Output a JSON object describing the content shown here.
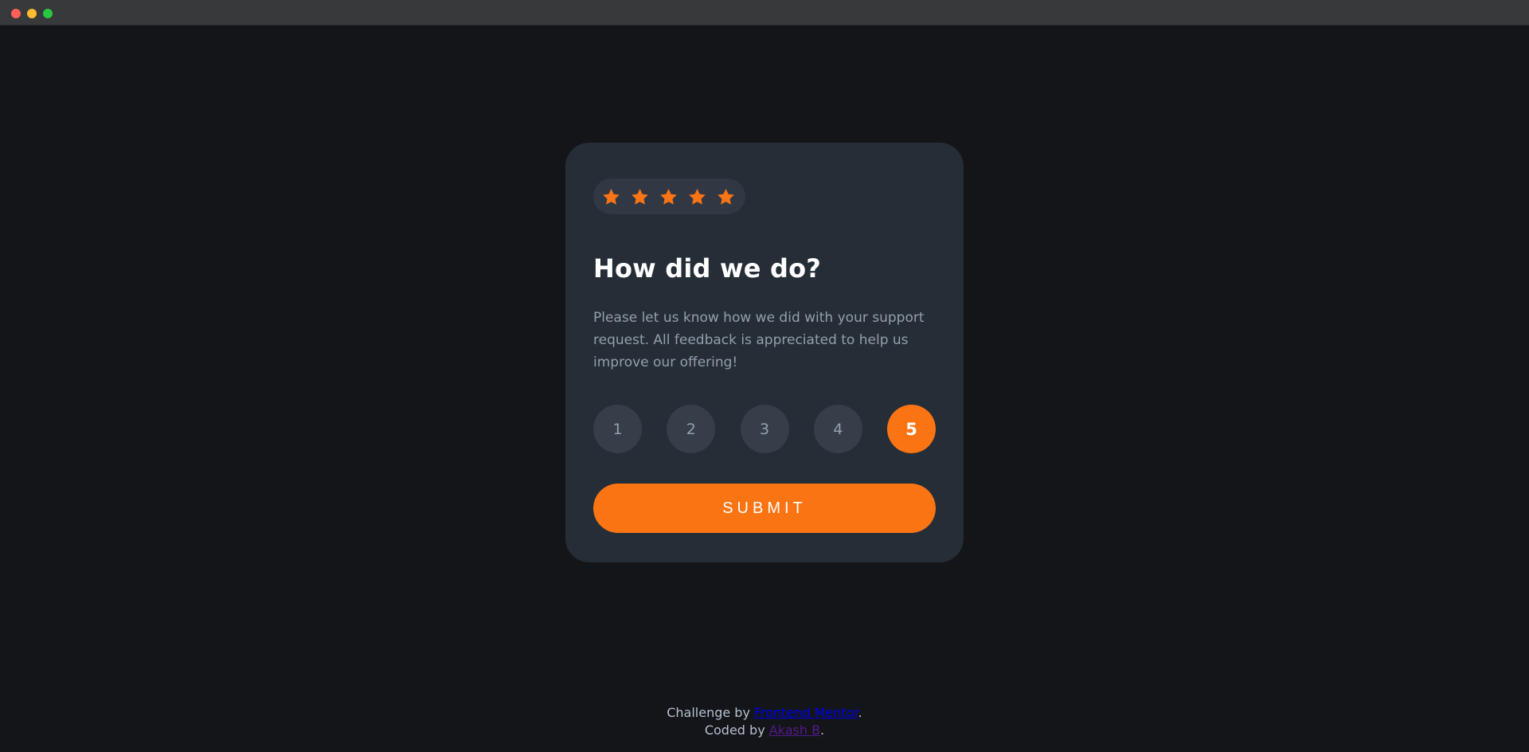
{
  "window": {
    "controls": [
      "close",
      "minimize",
      "zoom"
    ]
  },
  "card": {
    "stars": {
      "icon": "star-icon",
      "count": 5,
      "color": "#fb7413"
    },
    "title": "How did we do?",
    "description": "Please let us know how we did with your support request. All feedback is appreciated to help us improve our offering!",
    "ratings": [
      "1",
      "2",
      "3",
      "4",
      "5"
    ],
    "selected_rating": "5",
    "submit_label": "SUBMIT"
  },
  "attribution": {
    "challenge_prefix": "Challenge by",
    "challenge_link": "Frontend Mentor",
    "challenge_suffix": ".",
    "coded_prefix": "Coded by",
    "coded_link": "Akash B",
    "coded_suffix": "."
  },
  "colors": {
    "page_bg": "#131518",
    "card_bg": "#252d37",
    "accent": "#fb7413",
    "muted_text": "#959eac",
    "rating_bg": "#363e4a"
  }
}
